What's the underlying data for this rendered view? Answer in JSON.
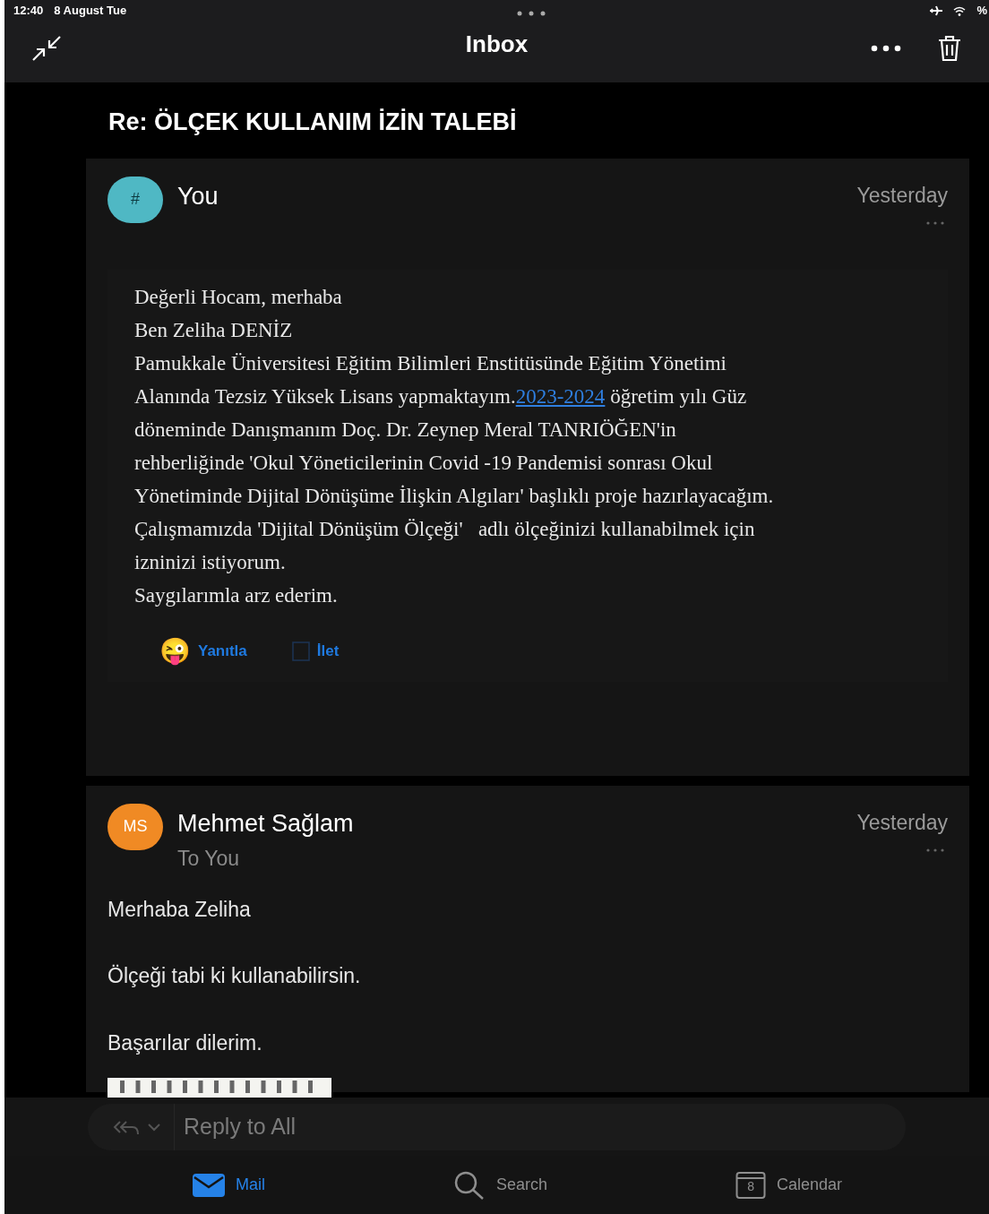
{
  "status_bar": {
    "time": "12:40",
    "date": "8 August Tue",
    "battery": "%"
  },
  "header": {
    "title": "Inbox"
  },
  "subject": "Re: ÖLÇEK KULLANIM İZİN TALEBİ",
  "messages": [
    {
      "avatar": "#",
      "color": "#4fb8c4",
      "sender": "You",
      "date": "Yesterday",
      "kind": "quoted",
      "lines": [
        {
          "text": "Değerli Hocam, merhaba"
        },
        {
          "text": "Ben Zeliha DENİZ"
        },
        {
          "text": "Pamukkale Üniversitesi Eğitim Bilimleri Enstitüsünde Eğitim Yönetimi"
        },
        {
          "text": "Alanında Tezsiz Yüksek Lisans yapmaktayım.",
          "link": "2023-2024",
          "after": " öğretim yılı Güz"
        },
        {
          "text": "döneminde Danışmanım Doç. Dr. Zeynep Meral TANRIÖĞEN'in"
        },
        {
          "text": "rehberliğinde 'Okul Yöneticilerinin Covid -19 Pandemisi sonrası Okul"
        },
        {
          "text": "Yönetiminde Dijital Dönüşüme İlişkin Algıları' başlıklı proje hazırlayacağım."
        },
        {
          "text": "Çalışmamızda 'Dijital Dönüşüm Ölçeği'   adlı ölçeğinizi kullanabilmek için"
        },
        {
          "text": "izninizi istiyorum."
        },
        {
          "text": "Saygılarımla arz ederim."
        }
      ],
      "actions": [
        {
          "icon": "😜",
          "label": "Yanıtla"
        },
        {
          "label": "İlet"
        }
      ]
    },
    {
      "avatar": "MS",
      "color": "#f08a24",
      "sender": "Mehmet Sağlam",
      "recipient": "To You",
      "date": "Yesterday",
      "kind": "plain",
      "lines": [
        {
          "text": "Merhaba Zeliha"
        },
        {
          "text": "Ölçeği tabi ki kullanabilirsin."
        },
        {
          "text": "Başarılar dilerim."
        }
      ]
    }
  ],
  "reply_bar": {
    "placeholder": "Reply to All"
  },
  "tabs": [
    {
      "label": "Mail",
      "selected": true
    },
    {
      "label": "Search",
      "selected": false
    },
    {
      "label": "Calendar",
      "selected": false,
      "day": "8"
    }
  ]
}
